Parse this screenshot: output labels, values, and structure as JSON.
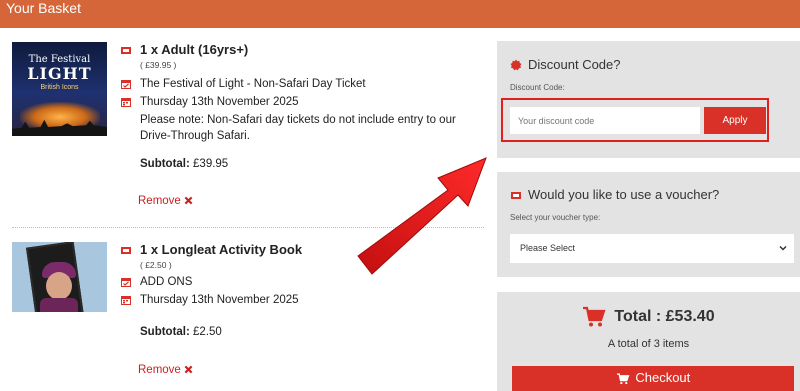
{
  "header": {
    "title": "Your Basket"
  },
  "items": [
    {
      "thumb_title_1": "The Festival",
      "thumb_title_2": "LIGHT",
      "thumb_title_3": "British Icons",
      "name": "1 x Adult (16yrs+)",
      "price": "( £39.95 )",
      "product": "The Festival of Light - Non-Safari Day Ticket",
      "date": "Thursday 13th November 2025",
      "note": "Please note: Non-Safari day tickets do not include entry to our Drive-Through Safari.",
      "subtotal_label": "Subtotal:",
      "subtotal_value": "£39.95",
      "remove_label": "Remove"
    },
    {
      "name": "1 x Longleat Activity Book",
      "price": "( £2.50 )",
      "product": "ADD ONS",
      "date": "Thursday 13th November 2025",
      "subtotal_label": "Subtotal:",
      "subtotal_value": "£2.50",
      "remove_label": "Remove"
    }
  ],
  "discount": {
    "title": "Discount Code?",
    "label": "Discount Code:",
    "placeholder": "Your discount code",
    "apply_label": "Apply"
  },
  "voucher": {
    "title": "Would you like to use a voucher?",
    "label": "Select your voucher type:",
    "selected": "Please Select"
  },
  "summary": {
    "total": "Total : £53.40",
    "count": "A total of 3 items",
    "checkout_label": "Checkout"
  },
  "colors": {
    "header": "#d4663a",
    "accent": "#d93027",
    "panel": "#e3e3e3"
  }
}
